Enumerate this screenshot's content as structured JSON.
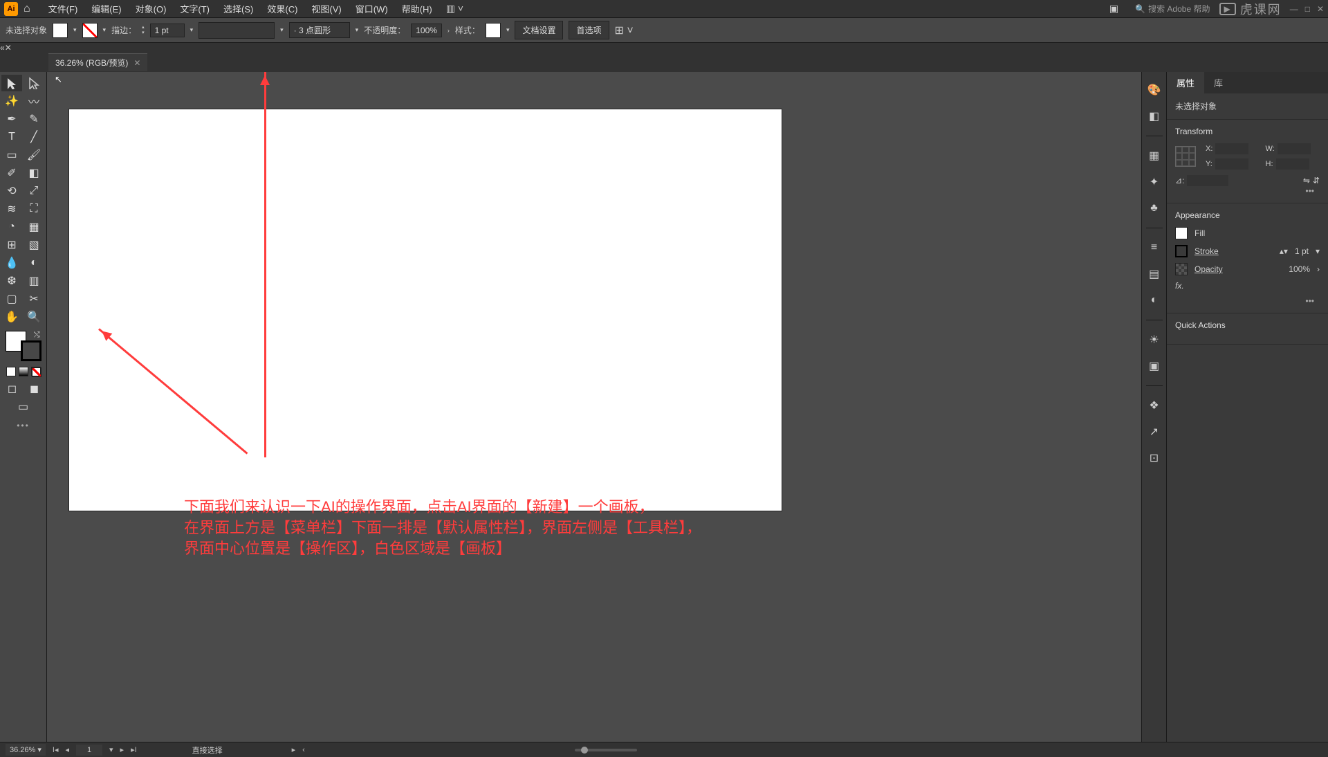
{
  "menu": {
    "items": [
      "文件(F)",
      "编辑(E)",
      "对象(O)",
      "文字(T)",
      "选择(S)",
      "效果(C)",
      "视图(V)",
      "窗口(W)",
      "帮助(H)"
    ],
    "search_placeholder": "搜索 Adobe 帮助"
  },
  "watermark": "虎课网",
  "control": {
    "no_selection": "未选择对象",
    "stroke_label": "描边：",
    "stroke_width": "1 pt",
    "brush_preset": "· 3 点圆形",
    "opacity_label": "不透明度：",
    "opacity_value": "100%",
    "style_label": "样式：",
    "doc_setup": "文档设置",
    "preferences": "首选项"
  },
  "tab": {
    "title": "36.26% (RGB/预览)"
  },
  "canvas": {
    "annotation_lines": [
      "下面我们来认识一下AI的操作界面，点击AI界面的【新建】一个画板，",
      "在界面上方是【菜单栏】下面一排是【默认属性栏】，界面左侧是【工具栏】，",
      "界面中心位置是【操作区】，白色区域是【画板】"
    ]
  },
  "properties": {
    "tabs": [
      "属性",
      "库"
    ],
    "no_selection": "未选择对象",
    "transform_label": "Transform",
    "x_label": "X:",
    "y_label": "Y:",
    "w_label": "W:",
    "h_label": "H:",
    "angle_label": "⊿:",
    "appearance_label": "Appearance",
    "fill_label": "Fill",
    "stroke_label": "Stroke",
    "stroke_value": "1 pt",
    "opacity_label": "Opacity",
    "opacity_value": "100%",
    "fx_label": "fx.",
    "quick_actions": "Quick Actions"
  },
  "status": {
    "zoom": "36.26%",
    "artboard_num": "1",
    "tool_hint": "直接选择"
  }
}
